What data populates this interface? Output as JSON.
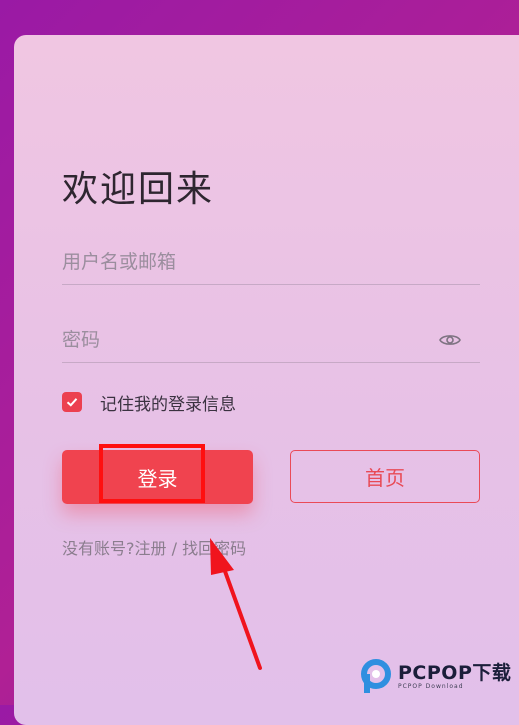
{
  "login": {
    "title": "欢迎回来",
    "username_placeholder": "用户名或邮箱",
    "password_placeholder": "密码",
    "remember_label": "记住我的登录信息",
    "remember_checked": true,
    "login_button": "登录",
    "home_button": "首页",
    "no_account_text": "没有账号?",
    "register_link": "注册",
    "separator": " / ",
    "forgot_link": "找回密码"
  },
  "icons": {
    "password_toggle": "eye-icon",
    "checkbox": "check-icon"
  },
  "colors": {
    "accent": "#f0434f",
    "highlight": "#ff0f0f"
  },
  "watermark": {
    "brand": "PCPOP下载",
    "sub": "PCPOP Download"
  }
}
